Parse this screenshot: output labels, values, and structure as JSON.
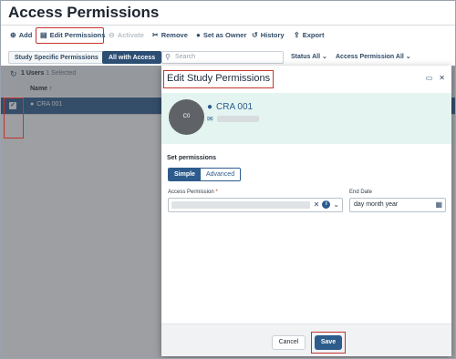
{
  "page": {
    "title": "Access Permissions"
  },
  "toolbar": {
    "add": "Add",
    "edit_permissions": "Edit Permissions",
    "activate": "Activate",
    "remove": "Remove",
    "set_as_owner": "Set as Owner",
    "history": "History",
    "export": "Export"
  },
  "filters": {
    "tab_study_specific": "Study Specific Permissions",
    "tab_all_with_access": "All with Access",
    "search_placeholder": "Search",
    "status": "Status All",
    "access_permission": "Access Permission All"
  },
  "grid": {
    "user_count": "1 Users",
    "selected": "1 Selected",
    "column_name": "Name",
    "rows": [
      {
        "name": "CRA 001"
      }
    ]
  },
  "modal": {
    "title": "Edit Study Permissions",
    "user": {
      "initials": "C0",
      "name": "CRA 001"
    },
    "set_permissions_label": "Set permissions",
    "mode_simple": "Simple",
    "mode_advanced": "Advanced",
    "access_permission_label": "Access Permission",
    "required_mark": "*",
    "end_date_label": "End Date",
    "end_date_value": "day month year",
    "cancel": "Cancel",
    "save": "Save"
  },
  "colors": {
    "accent": "#2c5b8c",
    "highlight_red": "#c4352f",
    "profile_bg": "#e4f5f1"
  }
}
